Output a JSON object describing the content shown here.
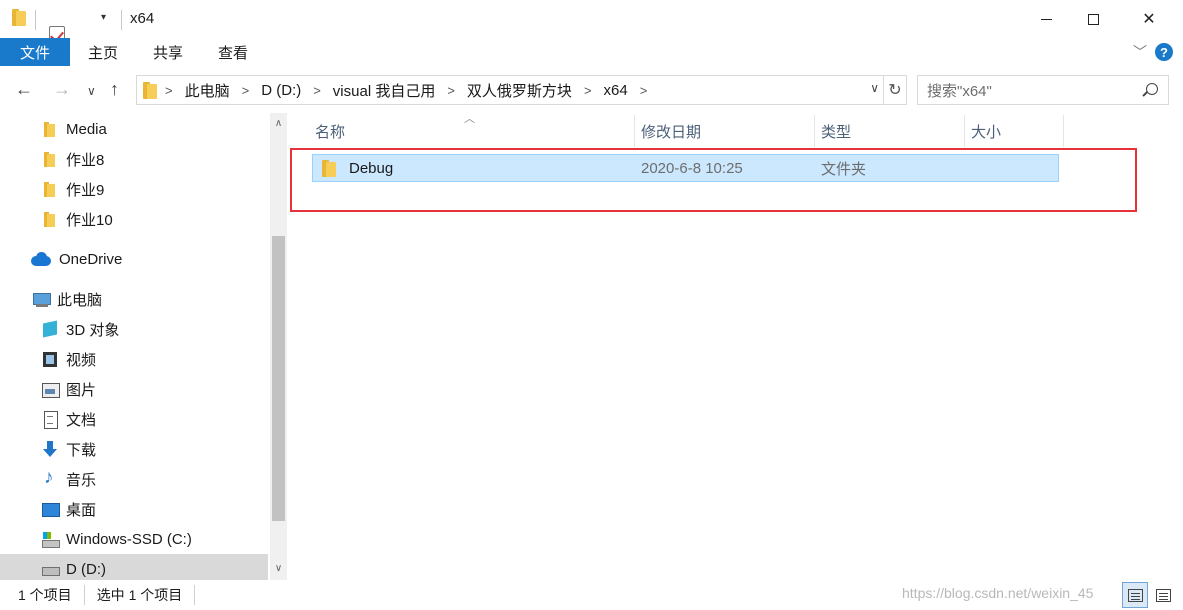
{
  "window": {
    "title": "x64",
    "controls": {
      "minimize": "minimize",
      "maximize": "maximize",
      "close": "✕"
    }
  },
  "ribbon": {
    "tabs": [
      "文件",
      "主页",
      "共享",
      "查看"
    ],
    "help": "?"
  },
  "address": {
    "crumbs": [
      "此电脑",
      "D (D:)",
      "visual 我自己用",
      "双人俄罗斯方块",
      "x64"
    ],
    "search_placeholder": "搜索\"x64\""
  },
  "navpane": {
    "items": [
      {
        "label": "Media",
        "icon": "folder-icon"
      },
      {
        "label": "作业8",
        "icon": "folder-icon"
      },
      {
        "label": "作业9",
        "icon": "folder-icon"
      },
      {
        "label": "作业10",
        "icon": "folder-icon"
      },
      {
        "label": "OneDrive",
        "icon": "onedrive-icon"
      },
      {
        "label": "此电脑",
        "icon": "this-pc-icon"
      },
      {
        "label": "3D 对象",
        "icon": "3d-objects-icon"
      },
      {
        "label": "视频",
        "icon": "video-icon"
      },
      {
        "label": "图片",
        "icon": "pictures-icon"
      },
      {
        "label": "文档",
        "icon": "documents-icon"
      },
      {
        "label": "下载",
        "icon": "downloads-icon"
      },
      {
        "label": "音乐",
        "icon": "music-icon"
      },
      {
        "label": "桌面",
        "icon": "desktop-icon"
      },
      {
        "label": "Windows-SSD (C:)",
        "icon": "windows-drive-icon"
      },
      {
        "label": "D (D:)",
        "icon": "drive-icon",
        "selected": true
      }
    ]
  },
  "columns": {
    "name": "名称",
    "date": "修改日期",
    "type": "类型",
    "size": "大小"
  },
  "files": [
    {
      "name": "Debug",
      "modified": "2020-6-8 10:25",
      "type": "文件夹",
      "size": ""
    }
  ],
  "status": {
    "count": "1 个项目",
    "selected": "选中 1 个项目",
    "watermark": "https://blog.csdn.net/weixin_45"
  },
  "colors": {
    "accent": "#1979ca",
    "selection": "#cce8ff",
    "highlight_border": "#e5323b"
  }
}
